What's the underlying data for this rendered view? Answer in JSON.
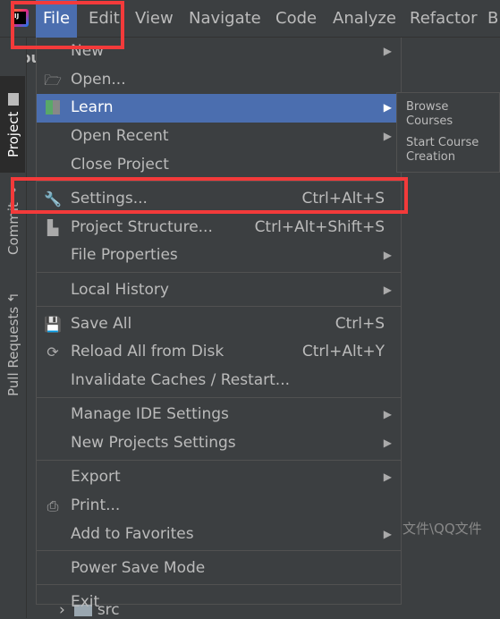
{
  "menubar": {
    "items": [
      {
        "label": "File"
      },
      {
        "label": "Edit"
      },
      {
        "label": "View"
      },
      {
        "label": "Navigate"
      },
      {
        "label": "Code"
      },
      {
        "label": "Analyze"
      },
      {
        "label": "Refactor"
      },
      {
        "label": "B"
      }
    ],
    "active": "File"
  },
  "logo": "IJ",
  "panel_title": "sou",
  "toolstrip": {
    "project": "Project",
    "commit": "Commit",
    "pull_requests": "Pull Requests"
  },
  "file_menu": [
    {
      "label": "New",
      "submenu": true
    },
    {
      "label": "Open...",
      "icon": "folder-open-icon"
    },
    {
      "label": "Learn",
      "icon": "book-icon",
      "submenu": true,
      "highlighted": true
    },
    {
      "label": "Open Recent",
      "submenu": true
    },
    {
      "label": "Close Project"
    },
    {
      "separator": true
    },
    {
      "label": "Settings...",
      "icon": "wrench-icon",
      "shortcut": "Ctrl+Alt+S"
    },
    {
      "label": "Project Structure...",
      "icon": "project-structure-icon",
      "shortcut": "Ctrl+Alt+Shift+S"
    },
    {
      "label": "File Properties",
      "submenu": true
    },
    {
      "separator": true
    },
    {
      "label": "Local History",
      "submenu": true
    },
    {
      "separator": true
    },
    {
      "label": "Save All",
      "icon": "save-icon",
      "shortcut": "Ctrl+S"
    },
    {
      "label": "Reload All from Disk",
      "icon": "reload-icon",
      "shortcut": "Ctrl+Alt+Y"
    },
    {
      "label": "Invalidate Caches / Restart..."
    },
    {
      "separator": true
    },
    {
      "label": "Manage IDE Settings",
      "submenu": true
    },
    {
      "label": "New Projects Settings",
      "submenu": true
    },
    {
      "separator": true
    },
    {
      "label": "Export",
      "submenu": true
    },
    {
      "label": "Print...",
      "icon": "print-icon"
    },
    {
      "label": "Add to Favorites",
      "submenu": true
    },
    {
      "separator": true
    },
    {
      "label": "Power Save Mode"
    },
    {
      "separator": true
    },
    {
      "label": "Exit"
    }
  ],
  "learn_submenu": [
    {
      "label": "Browse Courses"
    },
    {
      "label": "Start Course Creation"
    }
  ],
  "background": {
    "path_fragment": "文件\\QQ文件",
    "tree_item": "src"
  },
  "colors": {
    "highlight": "#4b6eaf",
    "annotation": "#f33a3a",
    "background": "#3c3f41"
  }
}
